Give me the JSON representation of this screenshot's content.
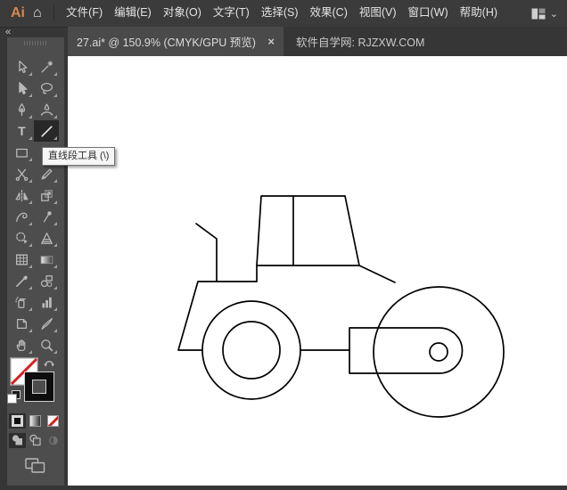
{
  "menu_bar": {
    "app_logo": "Ai",
    "icons": {
      "home_glyph": "⌂",
      "workspace": "workspace-switcher-icon",
      "workspace_chevron": "⌄"
    },
    "items": [
      {
        "id": "file",
        "label": "文件(F)"
      },
      {
        "id": "edit",
        "label": "编辑(E)"
      },
      {
        "id": "object",
        "label": "对象(O)"
      },
      {
        "id": "type",
        "label": "文字(T)"
      },
      {
        "id": "select",
        "label": "选择(S)"
      },
      {
        "id": "effect",
        "label": "效果(C)"
      },
      {
        "id": "view",
        "label": "视图(V)"
      },
      {
        "id": "window",
        "label": "窗口(W)"
      },
      {
        "id": "help",
        "label": "帮助(H)"
      }
    ]
  },
  "tab_bar": {
    "collapse_glyph": "«",
    "document_tab": {
      "title": "27.ai* @ 150.9% (CMYK/GPU 预览)",
      "close_glyph": "×"
    },
    "site_caption": "软件自学网: RJZXW.COM"
  },
  "toolbar": {
    "tooltip": "直线段工具 (\\)",
    "selected_tool": "line-segment-tool",
    "tools": [
      {
        "id": "selection-tool"
      },
      {
        "id": "magic-wand-tool"
      },
      {
        "id": "direct-selection-tool"
      },
      {
        "id": "lasso-tool"
      },
      {
        "id": "pen-tool"
      },
      {
        "id": "curvature-tool"
      },
      {
        "id": "type-tool"
      },
      {
        "id": "line-segment-tool",
        "selected": true
      },
      {
        "id": "rectangle-tool"
      },
      {
        "id": "paintbrush-tool"
      },
      {
        "id": "scissors-tool"
      },
      {
        "id": "pencil-tool"
      },
      {
        "id": "reflect-tool"
      },
      {
        "id": "scale-tool"
      },
      {
        "id": "width-tool"
      },
      {
        "id": "puppet-warp-tool"
      },
      {
        "id": "shape-builder-tool"
      },
      {
        "id": "perspective-grid-tool"
      },
      {
        "id": "mesh-tool"
      },
      {
        "id": "gradient-tool"
      },
      {
        "id": "eyedropper-tool"
      },
      {
        "id": "blend-tool"
      },
      {
        "id": "symbol-sprayer-tool"
      },
      {
        "id": "column-graph-tool"
      },
      {
        "id": "artboard-tool"
      },
      {
        "id": "slice-tool"
      },
      {
        "id": "hand-tool"
      },
      {
        "id": "zoom-tool"
      }
    ],
    "fill": "none",
    "stroke": "black",
    "color_type_buttons": [
      "color",
      "gradient",
      "none"
    ],
    "drawing_modes": [
      "draw-normal",
      "draw-behind",
      "draw-inside"
    ],
    "active_drawing_mode": "draw-normal"
  },
  "canvas": {
    "artwork": "road-roller line drawing",
    "background": "#ffffff",
    "stroke_color": "#000000"
  },
  "colors": {
    "menu_bar_bg": "#3b3b3b",
    "tab_bar_bg": "#363636",
    "active_tab_bg": "#4a4a4a",
    "panel_bg": "#4d4d4d",
    "icon_gray": "#b9b9b9",
    "logo_orange": "#d4874f",
    "none_red": "#d82020"
  }
}
